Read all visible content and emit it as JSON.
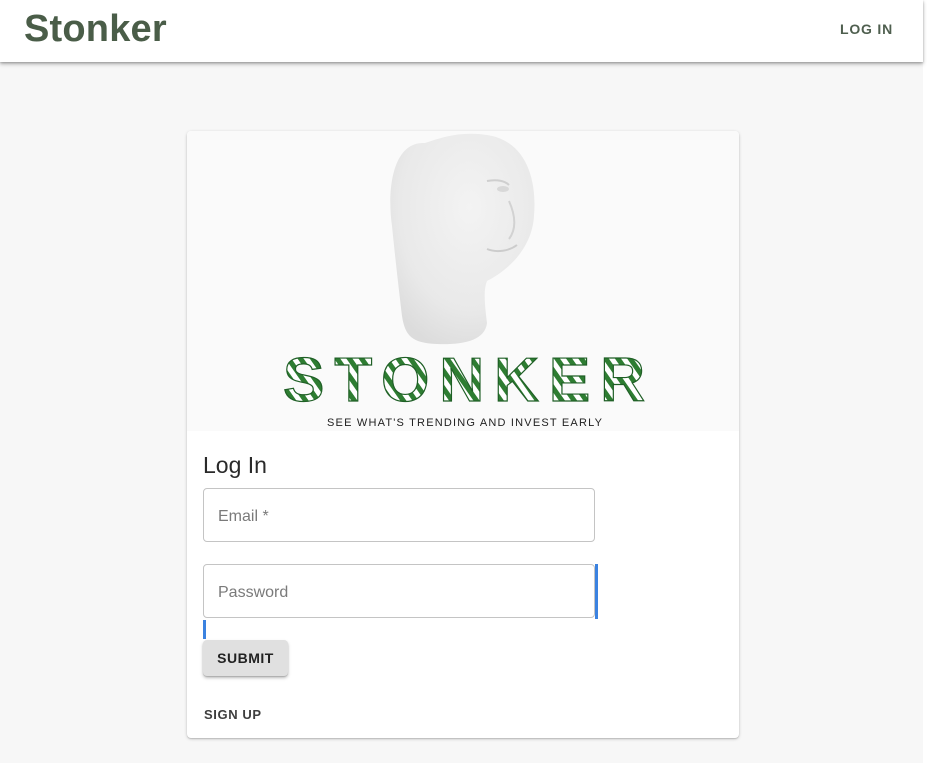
{
  "appbar": {
    "brand": "Stonker",
    "login_label": "LOG IN"
  },
  "hero": {
    "logo_word": "STONKER",
    "tagline": "SEE WHAT'S TRENDING AND INVEST EARLY"
  },
  "login_form": {
    "title": "Log In",
    "email": {
      "placeholder": "Email *",
      "value": ""
    },
    "password": {
      "placeholder": "Password",
      "value": ""
    },
    "submit_label": "SUBMIT",
    "signup_label": "SIGN UP"
  },
  "colors": {
    "brand_text": "#4a5d48",
    "logo_green": "#2e7d32",
    "focus_blue": "#3b82e0",
    "button_bg": "#e0e0e0"
  }
}
